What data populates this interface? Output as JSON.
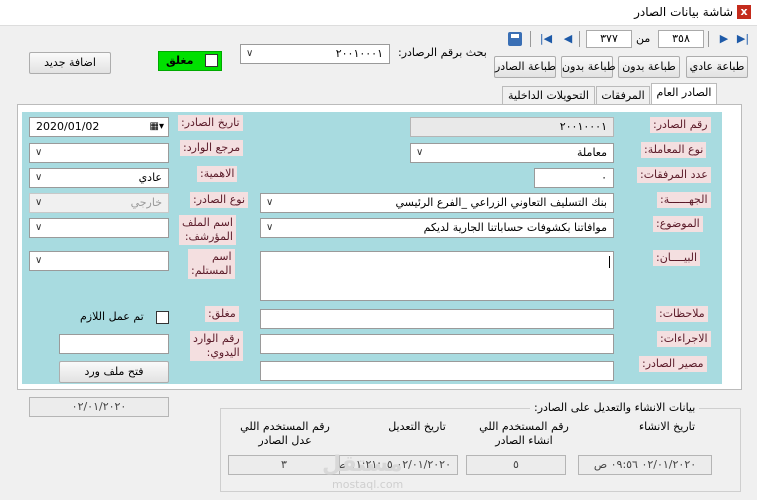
{
  "window": {
    "title": "شاشة بيانات الصادر",
    "close_label": "x"
  },
  "nav": {
    "current": "٣٥٨",
    "of_label": "من",
    "total": "٣٧٧"
  },
  "toolbar": {
    "print_normal": "طباعة عادي",
    "print_without": "طباعة بدون",
    "print_outgoing": "طباعة الصادر",
    "search_label": "بحث برقم الرصادر:",
    "search_value": "٢٠٠١٠٠٠١",
    "closed_label": "مغلق",
    "add_new": "اضافة جديد"
  },
  "tabs": [
    {
      "label": "الصادر العام"
    },
    {
      "label": "المرفقات"
    },
    {
      "label": "التحويلات الداخلية"
    }
  ],
  "form": {
    "outgoing_number_label": "رقم الصادر:",
    "outgoing_number": "٢٠٠١٠٠٠١",
    "transaction_type_label": "نوع المعاملة:",
    "transaction_type": "معاملة",
    "attachments_count_label": "عدد المرفقات:",
    "attachments_count": "٠",
    "entity_label": "الجهــــــة:",
    "entity": "بنك التسليف التعاوني الزراعي _الفرع الرئيسي",
    "subject_label": "الموضوع:",
    "subject": "موافاتنا بكشوفات حساباتنا الجارية لديكم",
    "details_label": "البيــــان:",
    "notes_label": "ملاحظات:",
    "actions_label": "الاجراءات:",
    "fate_label": "مصير الصادر:",
    "date_label": "تاريخ الصادر:",
    "date_value": "2020/01/02",
    "incoming_ref_label": "مرجع الوارد:",
    "importance_label": "الاهمية:",
    "importance": "عادي",
    "outgoing_type_label": "نوع الصادر:",
    "outgoing_type": "خارجي",
    "archive_file_label_1": "اسم الملف",
    "archive_file_label_2": "المؤرشف:",
    "recipient_label_1": "اسم",
    "recipient_label_2": "المستلم:",
    "done_label": "تم عمل اللازم",
    "closed_field_label": "مغلق:",
    "manual_incoming_label_1": "رقم الوارد",
    "manual_incoming_label_2": "اليدوي:",
    "open_word_button": "فتح ملف ورد"
  },
  "audit": {
    "side_date": "٠٢/٠١/٢٠٢٠",
    "group_title": "بيانات الانشاء والتعديل على الصادر:",
    "creation_date_label": "تاريخ الانشاء",
    "creator_user_label_1": "رقم المستخدم اللي",
    "creator_user_label_2": "انشاء الصادر",
    "modified_date_label": "تاريخ التعديل",
    "modifier_user_label_1": "رقم المستخدم اللي",
    "modifier_user_label_2": "عدل الصادر",
    "creation_date": "٠٢/٠١/٢٠٢٠ ٠٩:٥٦ ص",
    "creator_user": "٥",
    "modified_date": "٠٢/٠١/٢٠٢٠ ١١:٢١:٠٥ ص",
    "modifier_user": "٣"
  },
  "watermark": {
    "text": "مستقل",
    "domain": "mostaql.com"
  }
}
